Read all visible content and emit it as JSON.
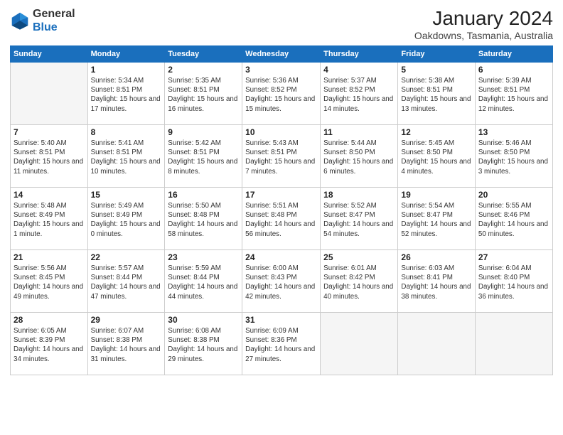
{
  "logo": {
    "general": "General",
    "blue": "Blue"
  },
  "header": {
    "month": "January 2024",
    "location": "Oakdowns, Tasmania, Australia"
  },
  "weekdays": [
    "Sunday",
    "Monday",
    "Tuesday",
    "Wednesday",
    "Thursday",
    "Friday",
    "Saturday"
  ],
  "weeks": [
    [
      {
        "day": "",
        "sunrise": "",
        "sunset": "",
        "daylight": ""
      },
      {
        "day": "1",
        "sunrise": "Sunrise: 5:34 AM",
        "sunset": "Sunset: 8:51 PM",
        "daylight": "Daylight: 15 hours and 17 minutes."
      },
      {
        "day": "2",
        "sunrise": "Sunrise: 5:35 AM",
        "sunset": "Sunset: 8:51 PM",
        "daylight": "Daylight: 15 hours and 16 minutes."
      },
      {
        "day": "3",
        "sunrise": "Sunrise: 5:36 AM",
        "sunset": "Sunset: 8:52 PM",
        "daylight": "Daylight: 15 hours and 15 minutes."
      },
      {
        "day": "4",
        "sunrise": "Sunrise: 5:37 AM",
        "sunset": "Sunset: 8:52 PM",
        "daylight": "Daylight: 15 hours and 14 minutes."
      },
      {
        "day": "5",
        "sunrise": "Sunrise: 5:38 AM",
        "sunset": "Sunset: 8:51 PM",
        "daylight": "Daylight: 15 hours and 13 minutes."
      },
      {
        "day": "6",
        "sunrise": "Sunrise: 5:39 AM",
        "sunset": "Sunset: 8:51 PM",
        "daylight": "Daylight: 15 hours and 12 minutes."
      }
    ],
    [
      {
        "day": "7",
        "sunrise": "Sunrise: 5:40 AM",
        "sunset": "Sunset: 8:51 PM",
        "daylight": "Daylight: 15 hours and 11 minutes."
      },
      {
        "day": "8",
        "sunrise": "Sunrise: 5:41 AM",
        "sunset": "Sunset: 8:51 PM",
        "daylight": "Daylight: 15 hours and 10 minutes."
      },
      {
        "day": "9",
        "sunrise": "Sunrise: 5:42 AM",
        "sunset": "Sunset: 8:51 PM",
        "daylight": "Daylight: 15 hours and 8 minutes."
      },
      {
        "day": "10",
        "sunrise": "Sunrise: 5:43 AM",
        "sunset": "Sunset: 8:51 PM",
        "daylight": "Daylight: 15 hours and 7 minutes."
      },
      {
        "day": "11",
        "sunrise": "Sunrise: 5:44 AM",
        "sunset": "Sunset: 8:50 PM",
        "daylight": "Daylight: 15 hours and 6 minutes."
      },
      {
        "day": "12",
        "sunrise": "Sunrise: 5:45 AM",
        "sunset": "Sunset: 8:50 PM",
        "daylight": "Daylight: 15 hours and 4 minutes."
      },
      {
        "day": "13",
        "sunrise": "Sunrise: 5:46 AM",
        "sunset": "Sunset: 8:50 PM",
        "daylight": "Daylight: 15 hours and 3 minutes."
      }
    ],
    [
      {
        "day": "14",
        "sunrise": "Sunrise: 5:48 AM",
        "sunset": "Sunset: 8:49 PM",
        "daylight": "Daylight: 15 hours and 1 minute."
      },
      {
        "day": "15",
        "sunrise": "Sunrise: 5:49 AM",
        "sunset": "Sunset: 8:49 PM",
        "daylight": "Daylight: 15 hours and 0 minutes."
      },
      {
        "day": "16",
        "sunrise": "Sunrise: 5:50 AM",
        "sunset": "Sunset: 8:48 PM",
        "daylight": "Daylight: 14 hours and 58 minutes."
      },
      {
        "day": "17",
        "sunrise": "Sunrise: 5:51 AM",
        "sunset": "Sunset: 8:48 PM",
        "daylight": "Daylight: 14 hours and 56 minutes."
      },
      {
        "day": "18",
        "sunrise": "Sunrise: 5:52 AM",
        "sunset": "Sunset: 8:47 PM",
        "daylight": "Daylight: 14 hours and 54 minutes."
      },
      {
        "day": "19",
        "sunrise": "Sunrise: 5:54 AM",
        "sunset": "Sunset: 8:47 PM",
        "daylight": "Daylight: 14 hours and 52 minutes."
      },
      {
        "day": "20",
        "sunrise": "Sunrise: 5:55 AM",
        "sunset": "Sunset: 8:46 PM",
        "daylight": "Daylight: 14 hours and 50 minutes."
      }
    ],
    [
      {
        "day": "21",
        "sunrise": "Sunrise: 5:56 AM",
        "sunset": "Sunset: 8:45 PM",
        "daylight": "Daylight: 14 hours and 49 minutes."
      },
      {
        "day": "22",
        "sunrise": "Sunrise: 5:57 AM",
        "sunset": "Sunset: 8:44 PM",
        "daylight": "Daylight: 14 hours and 47 minutes."
      },
      {
        "day": "23",
        "sunrise": "Sunrise: 5:59 AM",
        "sunset": "Sunset: 8:44 PM",
        "daylight": "Daylight: 14 hours and 44 minutes."
      },
      {
        "day": "24",
        "sunrise": "Sunrise: 6:00 AM",
        "sunset": "Sunset: 8:43 PM",
        "daylight": "Daylight: 14 hours and 42 minutes."
      },
      {
        "day": "25",
        "sunrise": "Sunrise: 6:01 AM",
        "sunset": "Sunset: 8:42 PM",
        "daylight": "Daylight: 14 hours and 40 minutes."
      },
      {
        "day": "26",
        "sunrise": "Sunrise: 6:03 AM",
        "sunset": "Sunset: 8:41 PM",
        "daylight": "Daylight: 14 hours and 38 minutes."
      },
      {
        "day": "27",
        "sunrise": "Sunrise: 6:04 AM",
        "sunset": "Sunset: 8:40 PM",
        "daylight": "Daylight: 14 hours and 36 minutes."
      }
    ],
    [
      {
        "day": "28",
        "sunrise": "Sunrise: 6:05 AM",
        "sunset": "Sunset: 8:39 PM",
        "daylight": "Daylight: 14 hours and 34 minutes."
      },
      {
        "day": "29",
        "sunrise": "Sunrise: 6:07 AM",
        "sunset": "Sunset: 8:38 PM",
        "daylight": "Daylight: 14 hours and 31 minutes."
      },
      {
        "day": "30",
        "sunrise": "Sunrise: 6:08 AM",
        "sunset": "Sunset: 8:38 PM",
        "daylight": "Daylight: 14 hours and 29 minutes."
      },
      {
        "day": "31",
        "sunrise": "Sunrise: 6:09 AM",
        "sunset": "Sunset: 8:36 PM",
        "daylight": "Daylight: 14 hours and 27 minutes."
      },
      {
        "day": "",
        "sunrise": "",
        "sunset": "",
        "daylight": ""
      },
      {
        "day": "",
        "sunrise": "",
        "sunset": "",
        "daylight": ""
      },
      {
        "day": "",
        "sunrise": "",
        "sunset": "",
        "daylight": ""
      }
    ]
  ]
}
